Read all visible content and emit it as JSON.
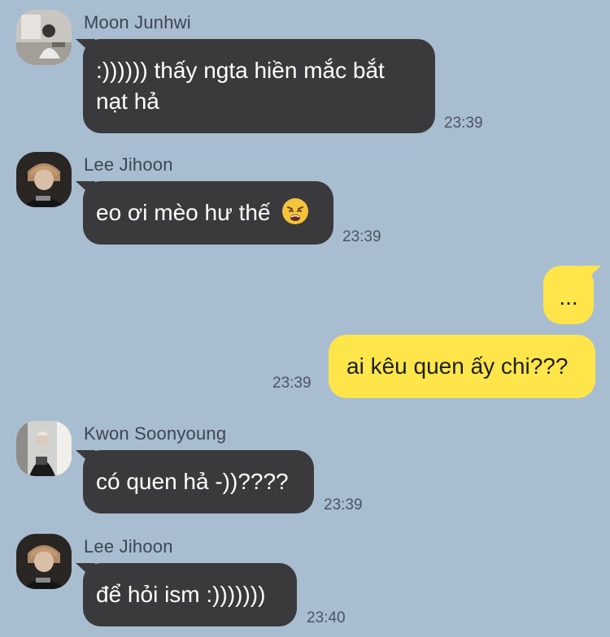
{
  "messages": [
    {
      "sender": "Moon Junhwi",
      "text": ":)))))) thấy ngta hiền mắc bắt nạt hả",
      "time": "23:39"
    },
    {
      "sender": "Lee Jihoon",
      "text": "eo ơi mèo hư thế",
      "emoji": "weary-face-emoji",
      "time": "23:39"
    },
    {
      "text": "...",
      "outgoing": true
    },
    {
      "text": "ai kêu quen ấy chi???",
      "outgoing": true,
      "time": "23:39"
    },
    {
      "sender": "Kwon Soonyoung",
      "text": "có quen hả -))????",
      "time": "23:39"
    },
    {
      "sender": "Lee Jihoon",
      "text": "để hỏi ism :)))))))",
      "time": "23:40"
    }
  ],
  "colors": {
    "background": "#a9bdd0",
    "incoming_bubble": "#3a3a3c",
    "outgoing_bubble": "#fee64a"
  }
}
